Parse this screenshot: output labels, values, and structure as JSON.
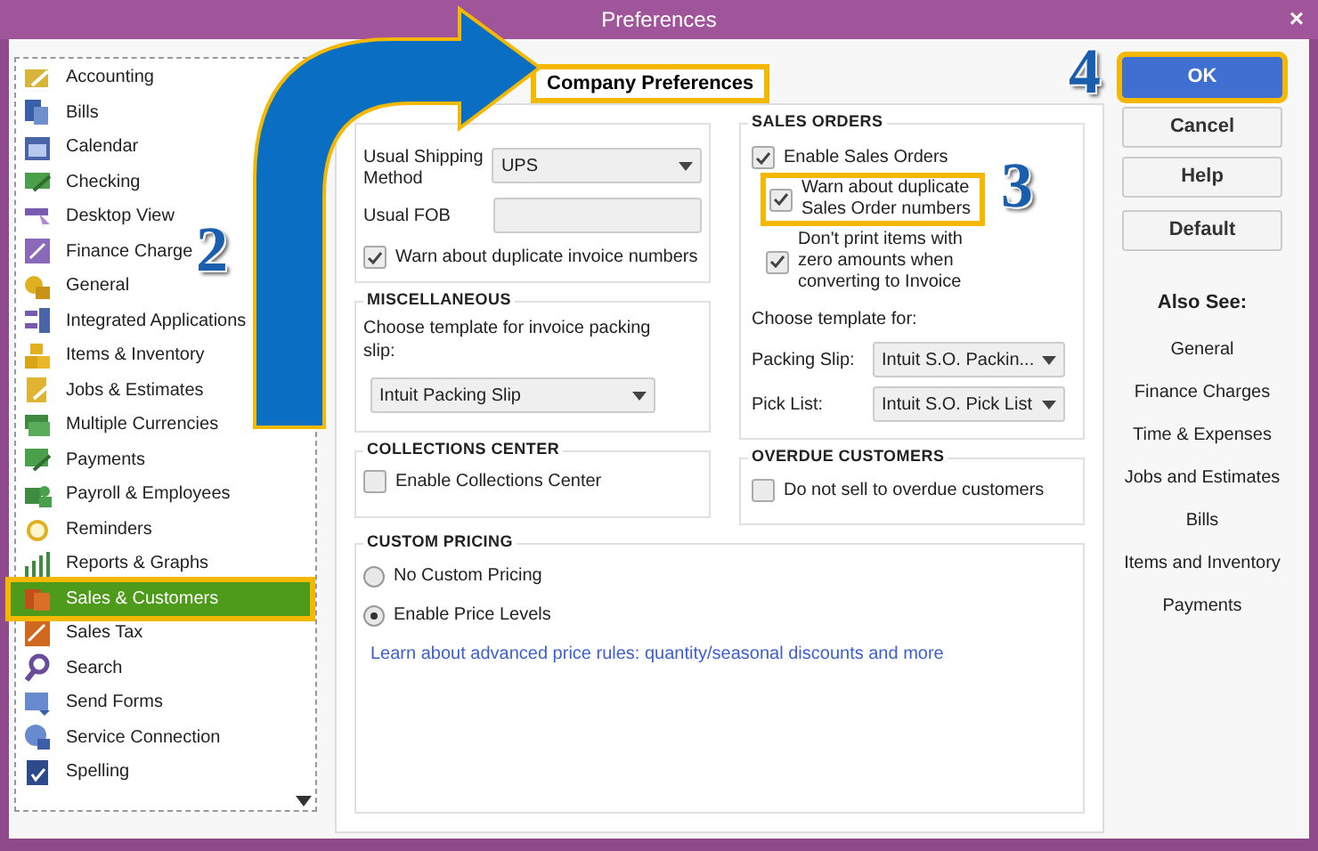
{
  "window": {
    "title": "Preferences",
    "close": "×"
  },
  "sidebar": {
    "items": [
      {
        "label": "Accounting",
        "selected": false,
        "highlighted": false
      },
      {
        "label": "Bills",
        "selected": false,
        "highlighted": false
      },
      {
        "label": "Calendar",
        "selected": false,
        "highlighted": false
      },
      {
        "label": "Checking",
        "selected": false,
        "highlighted": false
      },
      {
        "label": "Desktop View",
        "selected": false,
        "highlighted": false
      },
      {
        "label": "Finance Charge",
        "selected": false,
        "highlighted": false
      },
      {
        "label": "General",
        "selected": false,
        "highlighted": false
      },
      {
        "label": "Integrated Applications",
        "selected": false,
        "highlighted": false
      },
      {
        "label": "Items & Inventory",
        "selected": false,
        "highlighted": false
      },
      {
        "label": "Jobs & Estimates",
        "selected": false,
        "highlighted": false
      },
      {
        "label": "Multiple Currencies",
        "selected": false,
        "highlighted": false
      },
      {
        "label": "Payments",
        "selected": false,
        "highlighted": false
      },
      {
        "label": "Payroll & Employees",
        "selected": false,
        "highlighted": false
      },
      {
        "label": "Reminders",
        "selected": false,
        "highlighted": false
      },
      {
        "label": "Reports & Graphs",
        "selected": false,
        "highlighted": false
      },
      {
        "label": "Sales & Customers",
        "selected": true,
        "highlighted": true
      },
      {
        "label": "Sales Tax",
        "selected": false,
        "highlighted": false
      },
      {
        "label": "Search",
        "selected": false,
        "highlighted": false
      },
      {
        "label": "Send Forms",
        "selected": false,
        "highlighted": false
      },
      {
        "label": "Service Connection",
        "selected": false,
        "highlighted": false
      },
      {
        "label": "Spelling",
        "selected": false,
        "highlighted": false
      }
    ]
  },
  "tabs": [
    {
      "label": "Company Preferences",
      "selected": true,
      "highlighted": true
    }
  ],
  "sales_forms": {
    "shipping_label": "Usual Shipping Method",
    "shipping_value": "UPS",
    "fob_label": "Usual FOB",
    "warn": {
      "label": "Warn about duplicate invoice numbers",
      "checked": true
    }
  },
  "miscellaneous": {
    "title": "MISCELLANEOUS",
    "label": "Choose template for invoice packing slip:",
    "value": "Intuit Packing Slip"
  },
  "collections_center": {
    "title": "COLLECTIONS CENTER",
    "option": {
      "label": "Enable Collections Center",
      "checked": false
    }
  },
  "sales_orders": {
    "title": "SALES ORDERS",
    "options": [
      {
        "label": "Enable Sales Orders",
        "checked": true,
        "highlighted": false
      },
      {
        "label": "Warn about duplicate Sales Order numbers",
        "checked": true,
        "highlighted": true
      },
      {
        "label": "Don't print items with zero amounts when converting to Invoice",
        "checked": true,
        "highlighted": false
      }
    ],
    "template_label": "Choose template for:",
    "templates": [
      {
        "label": "Packing Slip:",
        "value": "Intuit S.O. Packin..."
      },
      {
        "label": "Pick List:",
        "value": "Intuit S.O. Pick List"
      }
    ]
  },
  "overdue_customers": {
    "title": "OVERDUE CUSTOMERS",
    "option": {
      "label": "Do not sell to overdue customers",
      "checked": false
    }
  },
  "custom_pricing": {
    "title": "CUSTOM PRICING",
    "options": [
      {
        "label": "No Custom Pricing",
        "selected": false
      },
      {
        "label": "Enable Price Levels",
        "selected": true
      }
    ],
    "link": "Learn about advanced price rules: quantity/seasonal discounts and more"
  },
  "buttons": [
    {
      "label": "OK",
      "primary": true,
      "highlighted": true
    },
    {
      "label": "Cancel",
      "primary": false,
      "highlighted": false
    },
    {
      "label": "Help",
      "primary": false,
      "highlighted": false
    },
    {
      "label": "Default",
      "primary": false,
      "highlighted": false
    }
  ],
  "also_see": {
    "title": "Also See:",
    "links": [
      "General",
      "Finance Charges",
      "Time & Expenses",
      "Jobs and Estimates",
      "Bills",
      "Items and Inventory",
      "Payments"
    ]
  },
  "step_labels": [
    "2",
    "3",
    "4"
  ]
}
